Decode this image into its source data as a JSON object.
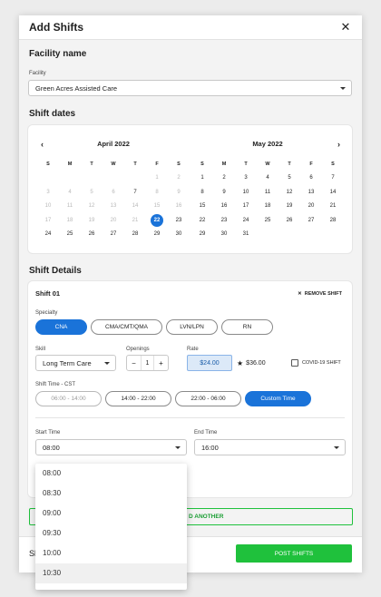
{
  "modal": {
    "title": "Add Shifts",
    "close_icon": "close-icon"
  },
  "facility": {
    "section_title": "Facility name",
    "label": "Facility",
    "value": "Green Acres Assisted Care"
  },
  "shift_dates": {
    "section_title": "Shift dates",
    "prev_icon": "chevron-left-icon",
    "next_icon": "chevron-right-icon",
    "weekdays": [
      "S",
      "M",
      "T",
      "W",
      "T",
      "F",
      "S"
    ],
    "months": [
      {
        "title": "April 2022",
        "weeks": [
          [
            "",
            "",
            "",
            "",
            "",
            "1",
            "2"
          ],
          [
            "3",
            "4",
            "5",
            "6",
            "7",
            "8",
            "9"
          ],
          [
            "10",
            "11",
            "12",
            "13",
            "14",
            "15",
            "16"
          ],
          [
            "17",
            "18",
            "19",
            "20",
            "21",
            "22",
            "23"
          ],
          [
            "24",
            "25",
            "26",
            "27",
            "28",
            "29",
            "30"
          ]
        ],
        "past": [
          "1",
          "2",
          "3",
          "4",
          "5",
          "6",
          "8",
          "9",
          "10",
          "11",
          "12",
          "13",
          "14",
          "15",
          "16",
          "17",
          "18",
          "19",
          "20",
          "21"
        ],
        "selected": "22"
      },
      {
        "title": "May 2022",
        "weeks": [
          [
            "1",
            "2",
            "3",
            "4",
            "5",
            "6",
            "7"
          ],
          [
            "8",
            "9",
            "10",
            "11",
            "12",
            "13",
            "14"
          ],
          [
            "15",
            "16",
            "17",
            "18",
            "19",
            "20",
            "21"
          ],
          [
            "22",
            "23",
            "24",
            "25",
            "26",
            "27",
            "28"
          ],
          [
            "29",
            "30",
            "31",
            "",
            "",
            "",
            ""
          ]
        ],
        "past": [],
        "selected": ""
      }
    ]
  },
  "shift_details": {
    "section_title": "Shift Details",
    "shift_title": "Shift  01",
    "remove_label": "REMOVE SHIFT",
    "specialty_label": "Specialty",
    "specialties": [
      "CNA",
      "CMA/CMT/QMA",
      "LVN/LPN",
      "RN"
    ],
    "active_specialty": "CNA",
    "skill_label": "Skill",
    "skill_value": "Long Term Care",
    "openings_label": "Openings",
    "openings_value": "1",
    "minus": "−",
    "plus": "+",
    "rate_label": "Rate",
    "rate_value": "$24.00",
    "rate_alt": "$36.00",
    "covid_label": "COVID-19 SHIFT",
    "shift_time_label": "Shift Time - CST",
    "time_options": [
      "06:00 - 14:00",
      "14:00 - 22:00",
      "22:00 - 06:00",
      "Custom Time"
    ],
    "active_time": "Custom Time",
    "start_label": "Start Time",
    "start_value": "08:00",
    "end_label": "End Time",
    "end_value": "16:00"
  },
  "start_dropdown": {
    "options": [
      "08:00",
      "08:30",
      "09:00",
      "09:30",
      "10:00",
      "10:30"
    ],
    "highlighted": "10:30"
  },
  "add_another_partial": "D ANOTHER",
  "footer": {
    "left_partial": "Sl",
    "post_label": "POST SHIFTS"
  },
  "colors": {
    "primary": "#1a73d9",
    "success": "#1fc13c",
    "rate_bg": "#dce9f8"
  }
}
